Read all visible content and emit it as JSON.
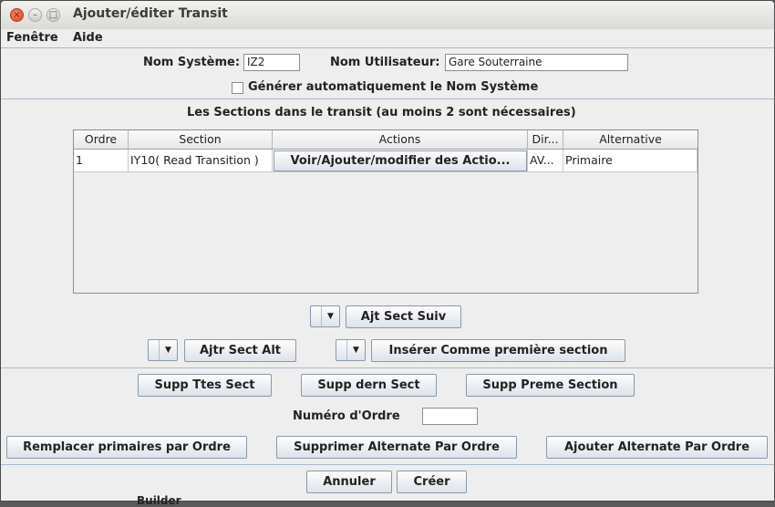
{
  "window": {
    "title": "Ajouter/éditer Transit",
    "controls": {
      "close": "×",
      "minimize": "–",
      "maximize": "□"
    }
  },
  "menubar": {
    "items": [
      "Fenêtre",
      "Aide"
    ]
  },
  "form": {
    "system_name_label": "Nom Système:",
    "system_name_value": "IZ2",
    "user_name_label": "Nom Utilisateur:",
    "user_name_value": "Gare Souterraine",
    "auto_generate_label": "Générer automatiquement le Nom Système",
    "auto_generate_checked": false
  },
  "sections": {
    "heading": "Les Sections dans le transit (au moins 2 sont nécessaires)",
    "columns": [
      "Ordre",
      "Section",
      "Actions",
      "Dir...",
      "Alternative"
    ],
    "rows": [
      {
        "order": "1",
        "section": "IY10( Read Transition )",
        "actions": "Voir/Ajouter/modifier des Actio...",
        "direction": "AV...",
        "alternative": "Primaire"
      }
    ]
  },
  "controls": {
    "add_next_section": "Ajt Sect Suiv",
    "add_alt_section": "Ajtr Sect Alt",
    "insert_first_section": "Insérer Comme première section",
    "dropdown_arrow": "▼"
  },
  "actions": {
    "delete_all_sections": "Supp Ttes Sect",
    "delete_last_section": "Supp dern Sect",
    "delete_first_section": "Supp Preme Section",
    "order_number_label": "Numéro d'Ordre",
    "order_number_value": "",
    "replace_primary_by_order": "Remplacer primaires par Ordre",
    "delete_alternate_by_order": "Supprimer Alternate Par Ordre",
    "add_alternate_by_order": "Ajouter Alternate Par Ordre"
  },
  "footer": {
    "cancel": "Annuler",
    "create": "Créer"
  },
  "background": {
    "partial_text": "Builder"
  },
  "colors": {
    "close_button": "#d8441c",
    "separator": "#a9b9cf",
    "button_border": "#8b98aa"
  }
}
